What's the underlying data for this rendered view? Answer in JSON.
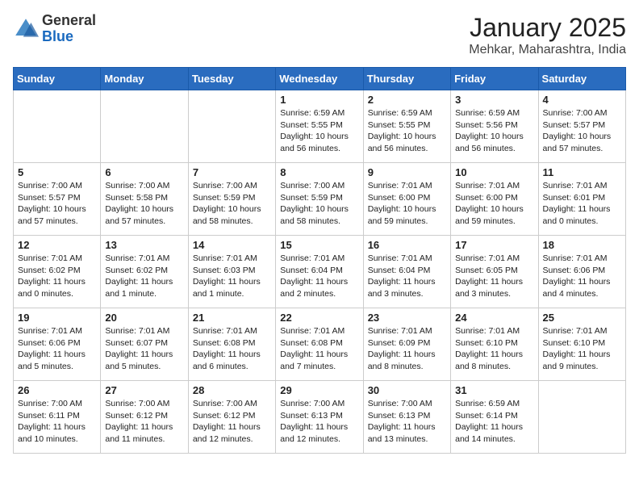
{
  "header": {
    "logo_general": "General",
    "logo_blue": "Blue",
    "title": "January 2025",
    "subtitle": "Mehkar, Maharashtra, India"
  },
  "weekdays": [
    "Sunday",
    "Monday",
    "Tuesday",
    "Wednesday",
    "Thursday",
    "Friday",
    "Saturday"
  ],
  "weeks": [
    [
      {
        "day": "",
        "info": ""
      },
      {
        "day": "",
        "info": ""
      },
      {
        "day": "",
        "info": ""
      },
      {
        "day": "1",
        "info": "Sunrise: 6:59 AM\nSunset: 5:55 PM\nDaylight: 10 hours\nand 56 minutes."
      },
      {
        "day": "2",
        "info": "Sunrise: 6:59 AM\nSunset: 5:55 PM\nDaylight: 10 hours\nand 56 minutes."
      },
      {
        "day": "3",
        "info": "Sunrise: 6:59 AM\nSunset: 5:56 PM\nDaylight: 10 hours\nand 56 minutes."
      },
      {
        "day": "4",
        "info": "Sunrise: 7:00 AM\nSunset: 5:57 PM\nDaylight: 10 hours\nand 57 minutes."
      }
    ],
    [
      {
        "day": "5",
        "info": "Sunrise: 7:00 AM\nSunset: 5:57 PM\nDaylight: 10 hours\nand 57 minutes."
      },
      {
        "day": "6",
        "info": "Sunrise: 7:00 AM\nSunset: 5:58 PM\nDaylight: 10 hours\nand 57 minutes."
      },
      {
        "day": "7",
        "info": "Sunrise: 7:00 AM\nSunset: 5:59 PM\nDaylight: 10 hours\nand 58 minutes."
      },
      {
        "day": "8",
        "info": "Sunrise: 7:00 AM\nSunset: 5:59 PM\nDaylight: 10 hours\nand 58 minutes."
      },
      {
        "day": "9",
        "info": "Sunrise: 7:01 AM\nSunset: 6:00 PM\nDaylight: 10 hours\nand 59 minutes."
      },
      {
        "day": "10",
        "info": "Sunrise: 7:01 AM\nSunset: 6:00 PM\nDaylight: 10 hours\nand 59 minutes."
      },
      {
        "day": "11",
        "info": "Sunrise: 7:01 AM\nSunset: 6:01 PM\nDaylight: 11 hours\nand 0 minutes."
      }
    ],
    [
      {
        "day": "12",
        "info": "Sunrise: 7:01 AM\nSunset: 6:02 PM\nDaylight: 11 hours\nand 0 minutes."
      },
      {
        "day": "13",
        "info": "Sunrise: 7:01 AM\nSunset: 6:02 PM\nDaylight: 11 hours\nand 1 minute."
      },
      {
        "day": "14",
        "info": "Sunrise: 7:01 AM\nSunset: 6:03 PM\nDaylight: 11 hours\nand 1 minute."
      },
      {
        "day": "15",
        "info": "Sunrise: 7:01 AM\nSunset: 6:04 PM\nDaylight: 11 hours\nand 2 minutes."
      },
      {
        "day": "16",
        "info": "Sunrise: 7:01 AM\nSunset: 6:04 PM\nDaylight: 11 hours\nand 3 minutes."
      },
      {
        "day": "17",
        "info": "Sunrise: 7:01 AM\nSunset: 6:05 PM\nDaylight: 11 hours\nand 3 minutes."
      },
      {
        "day": "18",
        "info": "Sunrise: 7:01 AM\nSunset: 6:06 PM\nDaylight: 11 hours\nand 4 minutes."
      }
    ],
    [
      {
        "day": "19",
        "info": "Sunrise: 7:01 AM\nSunset: 6:06 PM\nDaylight: 11 hours\nand 5 minutes."
      },
      {
        "day": "20",
        "info": "Sunrise: 7:01 AM\nSunset: 6:07 PM\nDaylight: 11 hours\nand 5 minutes."
      },
      {
        "day": "21",
        "info": "Sunrise: 7:01 AM\nSunset: 6:08 PM\nDaylight: 11 hours\nand 6 minutes."
      },
      {
        "day": "22",
        "info": "Sunrise: 7:01 AM\nSunset: 6:08 PM\nDaylight: 11 hours\nand 7 minutes."
      },
      {
        "day": "23",
        "info": "Sunrise: 7:01 AM\nSunset: 6:09 PM\nDaylight: 11 hours\nand 8 minutes."
      },
      {
        "day": "24",
        "info": "Sunrise: 7:01 AM\nSunset: 6:10 PM\nDaylight: 11 hours\nand 8 minutes."
      },
      {
        "day": "25",
        "info": "Sunrise: 7:01 AM\nSunset: 6:10 PM\nDaylight: 11 hours\nand 9 minutes."
      }
    ],
    [
      {
        "day": "26",
        "info": "Sunrise: 7:00 AM\nSunset: 6:11 PM\nDaylight: 11 hours\nand 10 minutes."
      },
      {
        "day": "27",
        "info": "Sunrise: 7:00 AM\nSunset: 6:12 PM\nDaylight: 11 hours\nand 11 minutes."
      },
      {
        "day": "28",
        "info": "Sunrise: 7:00 AM\nSunset: 6:12 PM\nDaylight: 11 hours\nand 12 minutes."
      },
      {
        "day": "29",
        "info": "Sunrise: 7:00 AM\nSunset: 6:13 PM\nDaylight: 11 hours\nand 12 minutes."
      },
      {
        "day": "30",
        "info": "Sunrise: 7:00 AM\nSunset: 6:13 PM\nDaylight: 11 hours\nand 13 minutes."
      },
      {
        "day": "31",
        "info": "Sunrise: 6:59 AM\nSunset: 6:14 PM\nDaylight: 11 hours\nand 14 minutes."
      },
      {
        "day": "",
        "info": ""
      }
    ]
  ]
}
